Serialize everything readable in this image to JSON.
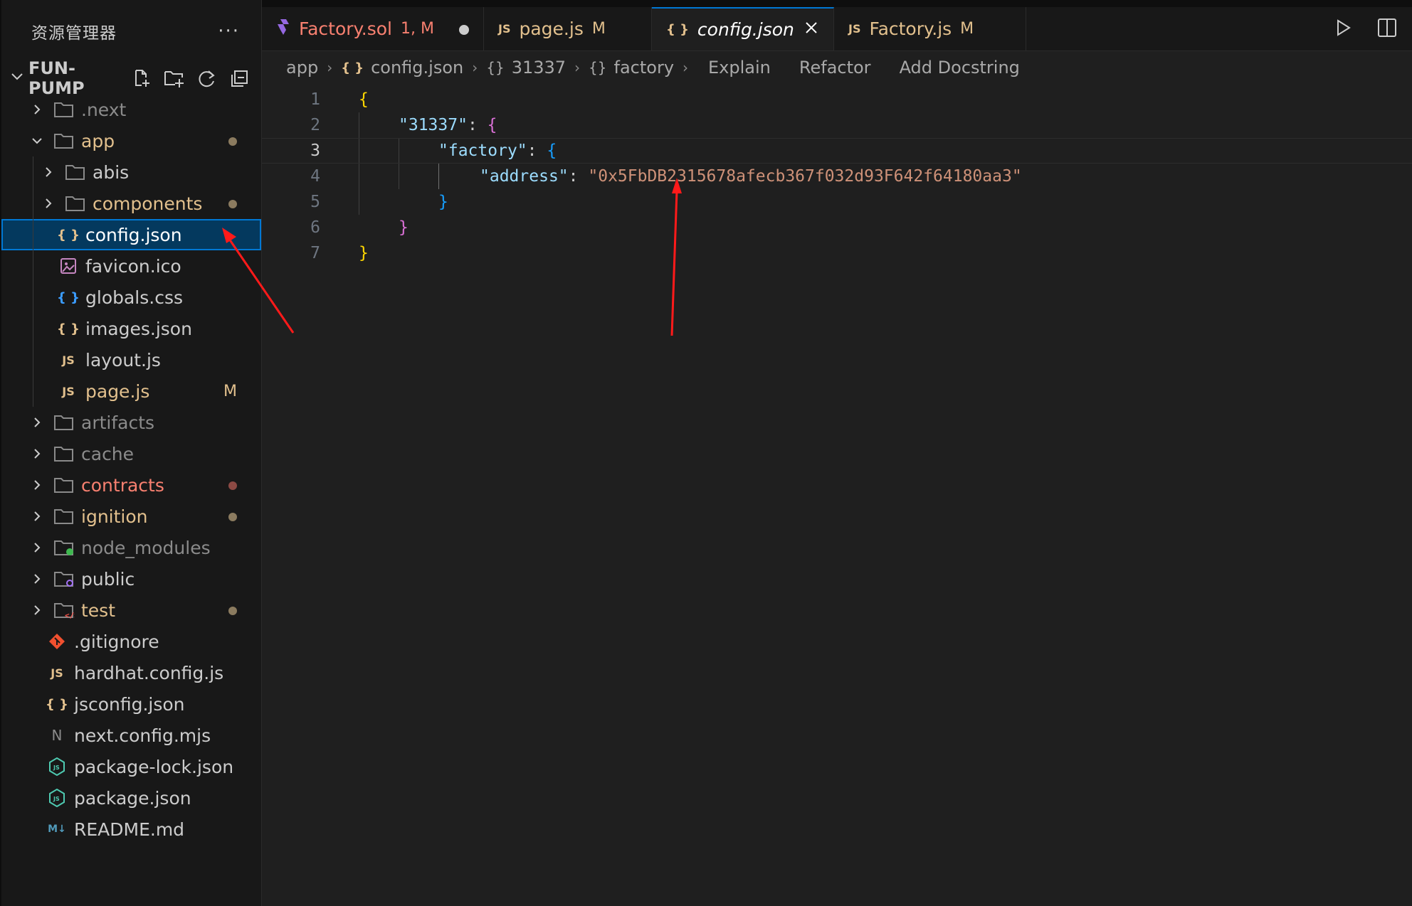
{
  "explorer": {
    "title": "资源管理器",
    "more": "···",
    "project": "FUN-PUMP"
  },
  "tree": [
    {
      "label": ".next",
      "type": "folder",
      "level": 0,
      "expanded": false,
      "color": "#8b8b8b"
    },
    {
      "label": "app",
      "type": "folder",
      "level": 0,
      "expanded": true,
      "color": "#e2c08d",
      "dot": "#8b7b5f"
    },
    {
      "label": "abis",
      "type": "folder",
      "level": 1,
      "expanded": false,
      "color": "#cccccc"
    },
    {
      "label": "components",
      "type": "folder",
      "level": 1,
      "expanded": false,
      "color": "#e2c08d",
      "dot": "#8b7b5f"
    },
    {
      "label": "config.json",
      "type": "json",
      "level": 1,
      "color": "#ffffff",
      "selected": true
    },
    {
      "label": "favicon.ico",
      "type": "image",
      "level": 1,
      "color": "#cccccc"
    },
    {
      "label": "globals.css",
      "type": "css",
      "level": 1,
      "color": "#cccccc"
    },
    {
      "label": "images.json",
      "type": "json",
      "level": 1,
      "color": "#cccccc"
    },
    {
      "label": "layout.js",
      "type": "js",
      "level": 1,
      "color": "#cccccc"
    },
    {
      "label": "page.js",
      "type": "js",
      "level": 1,
      "color": "#e2c08d",
      "badge": "M"
    },
    {
      "label": "artifacts",
      "type": "folder",
      "level": 0,
      "expanded": false,
      "color": "#8b8b8b"
    },
    {
      "label": "cache",
      "type": "folder",
      "level": 0,
      "expanded": false,
      "color": "#8b8b8b"
    },
    {
      "label": "contracts",
      "type": "folder",
      "level": 0,
      "expanded": false,
      "color": "#f88070",
      "dot": "#8c4a44"
    },
    {
      "label": "ignition",
      "type": "folder",
      "level": 0,
      "expanded": false,
      "color": "#e2c08d",
      "dot": "#8b7b5f"
    },
    {
      "label": "node_modules",
      "type": "folder-node",
      "level": 0,
      "expanded": false,
      "color": "#8b8b8b"
    },
    {
      "label": "public",
      "type": "folder-public",
      "level": 0,
      "expanded": false,
      "color": "#cccccc"
    },
    {
      "label": "test",
      "type": "folder-test",
      "level": 0,
      "expanded": false,
      "color": "#e2c08d",
      "dot": "#8b7b5f"
    },
    {
      "label": ".gitignore",
      "type": "git",
      "level": 0,
      "color": "#cccccc",
      "file": true
    },
    {
      "label": "hardhat.config.js",
      "type": "js",
      "level": 0,
      "color": "#cccccc",
      "file": true
    },
    {
      "label": "jsconfig.json",
      "type": "json",
      "level": 0,
      "color": "#cccccc",
      "file": true
    },
    {
      "label": "next.config.mjs",
      "type": "next",
      "level": 0,
      "color": "#cccccc",
      "file": true
    },
    {
      "label": "package-lock.json",
      "type": "npm",
      "level": 0,
      "color": "#cccccc",
      "file": true
    },
    {
      "label": "package.json",
      "type": "npm",
      "level": 0,
      "color": "#cccccc",
      "file": true
    },
    {
      "label": "README.md",
      "type": "md",
      "level": 0,
      "color": "#cccccc",
      "file": true
    }
  ],
  "tabs": [
    {
      "label": "Factory.sol",
      "status": "1, M",
      "icon": "solidity",
      "color": "#f88070",
      "dirty": true
    },
    {
      "label": "page.js",
      "status": "M",
      "icon": "js",
      "color": "#e2c08d"
    },
    {
      "label": "config.json",
      "status": "",
      "icon": "json",
      "color": "#ffffff",
      "active": true
    },
    {
      "label": "Factory.js",
      "status": "M",
      "icon": "js",
      "color": "#e2c08d"
    }
  ],
  "breadcrumb": {
    "parts": [
      "app",
      "config.json",
      "31337",
      "factory"
    ],
    "actions": [
      "Explain",
      "Refactor",
      "Add Docstring"
    ]
  },
  "code": {
    "line_numbers": [
      "1",
      "2",
      "3",
      "4",
      "5",
      "6",
      "7"
    ],
    "current_line": 3,
    "key_chain": "31337",
    "key_factory": "factory",
    "key_address": "address",
    "address_value": "0x5FbDB2315678afecb367f032d93F642f64180aa3"
  },
  "icons": {
    "json": "{ }",
    "js": "JS",
    "md": "M↓"
  }
}
